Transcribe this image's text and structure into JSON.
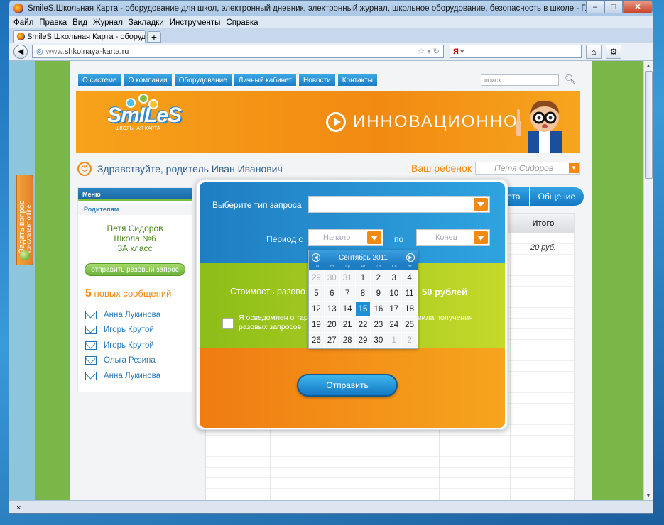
{
  "browser": {
    "title": "SmileS.Школьная Карта - оборудование для школ, электронный дневник, электронный журнал, школьное оборудование, безопасность в школе - Главная страница - Mozilla Firefox",
    "menu": [
      "Файл",
      "Правка",
      "Вид",
      "Журнал",
      "Закладки",
      "Инструменты",
      "Справка"
    ],
    "tab_title": "SmileS.Школьная Карта - оборудовани...",
    "url_prefix": "www.",
    "url": "shkolnaya-karta.ru",
    "search_icon": "yandex-icon",
    "status_close": "×"
  },
  "site": {
    "nav": [
      "О системе",
      "О компании",
      "Оборудование",
      "Личный кабинет",
      "Новости",
      "Контакты"
    ],
    "search_placeholder": "поиск...",
    "logo_word": "SmILeS",
    "logo_sub": "ШКОЛЬНАЯ КАРТА",
    "banner_text": "ИННОВАЦИОННО",
    "greeting": "Здравствуйте, родитель Иван Иванович",
    "child_label": "Ваш ребенок",
    "child_value": "Петя Сидоров",
    "ask_question": "Задать вопрос",
    "ask_sub": "консультант online"
  },
  "sidebar": {
    "menu_title": "Меню",
    "section": "Родителям",
    "child_name": "Петя Сидоров",
    "school": "Школа №6",
    "class": "3А класс",
    "request_button": "отправить разовый запрос",
    "msg_count": "5",
    "msg_label": "новых сообщений",
    "messages": [
      "Анна Лукинова",
      "Игорь Крутой",
      "Игорь Крутой",
      "Ольга Резина",
      "Анна Лукинова"
    ]
  },
  "right": {
    "tabs": [
      "чета",
      "Общение"
    ],
    "col_total": "Итого",
    "total_value": "20 руб."
  },
  "modal": {
    "type_label": "Выберите тип запроса",
    "period_label": "Период с",
    "from_placeholder": "Начало",
    "to_label": "по",
    "to_placeholder": "Конец",
    "cost_label": "Стоимость разово",
    "price": "50 рублей",
    "agree_text": "Я осведомлен о тар разовых запросов",
    "rules_text": "вила получения",
    "send_button": "Отправить"
  },
  "calendar": {
    "month": "Сентябрь 2011",
    "weekdays": [
      "Пн",
      "Вт",
      "Ср",
      "Чт",
      "Пт",
      "Сб",
      "Вс"
    ],
    "days": [
      [
        "29",
        "30",
        "31",
        "1",
        "2",
        "3",
        "4"
      ],
      [
        "5",
        "6",
        "7",
        "8",
        "9",
        "10",
        "11"
      ],
      [
        "12",
        "13",
        "14",
        "15",
        "16",
        "17",
        "18"
      ],
      [
        "19",
        "20",
        "21",
        "22",
        "23",
        "24",
        "25"
      ],
      [
        "26",
        "27",
        "28",
        "29",
        "30",
        "1",
        "2"
      ]
    ],
    "other_month": [
      [
        0,
        0
      ],
      [
        0,
        1
      ],
      [
        0,
        2
      ],
      [
        4,
        5
      ],
      [
        4,
        6
      ]
    ],
    "today": [
      2,
      3
    ]
  }
}
